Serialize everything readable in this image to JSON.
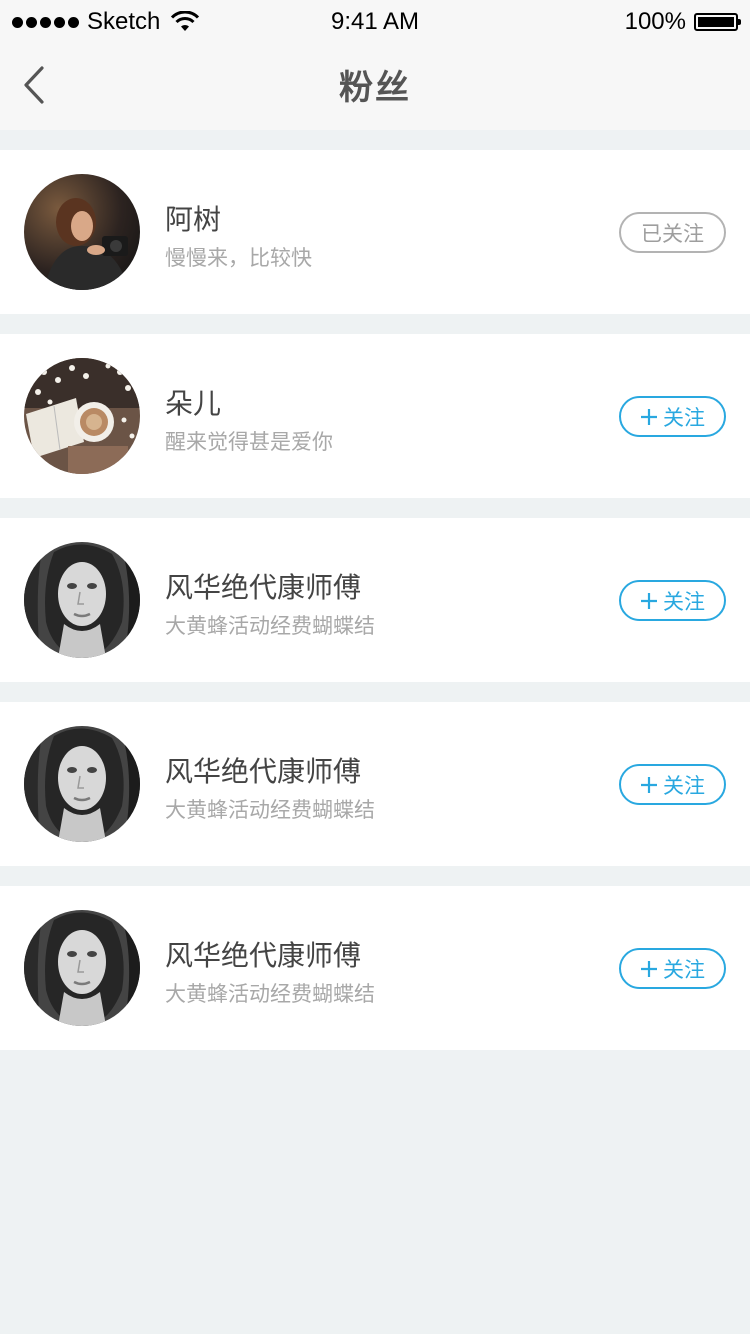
{
  "status_bar": {
    "carrier": "Sketch",
    "time": "9:41 AM",
    "battery": "100%"
  },
  "nav": {
    "title": "粉丝",
    "back_icon": "chevron-left-icon"
  },
  "colors": {
    "accent": "#29a8e0",
    "followed_border": "#b3b3b3",
    "background": "#eef2f3"
  },
  "fans": [
    {
      "name": "阿树",
      "desc": "慢慢来，比较快",
      "button": "已关注",
      "followed": true,
      "avatar": "woman-camera-photo"
    },
    {
      "name": "朵儿",
      "desc": "醒来觉得甚是爱你",
      "button": "关注",
      "followed": false,
      "avatar": "coffee-flowers-photo"
    },
    {
      "name": "风华绝代康师傅",
      "desc": "大黄蜂活动经费蝴蝶结",
      "button": "关注",
      "followed": false,
      "avatar": "woman-portrait-bw-photo"
    },
    {
      "name": "风华绝代康师傅",
      "desc": "大黄蜂活动经费蝴蝶结",
      "button": "关注",
      "followed": false,
      "avatar": "woman-portrait-bw-photo"
    },
    {
      "name": "风华绝代康师傅",
      "desc": "大黄蜂活动经费蝴蝶结",
      "button": "关注",
      "followed": false,
      "avatar": "woman-portrait-bw-photo"
    }
  ]
}
